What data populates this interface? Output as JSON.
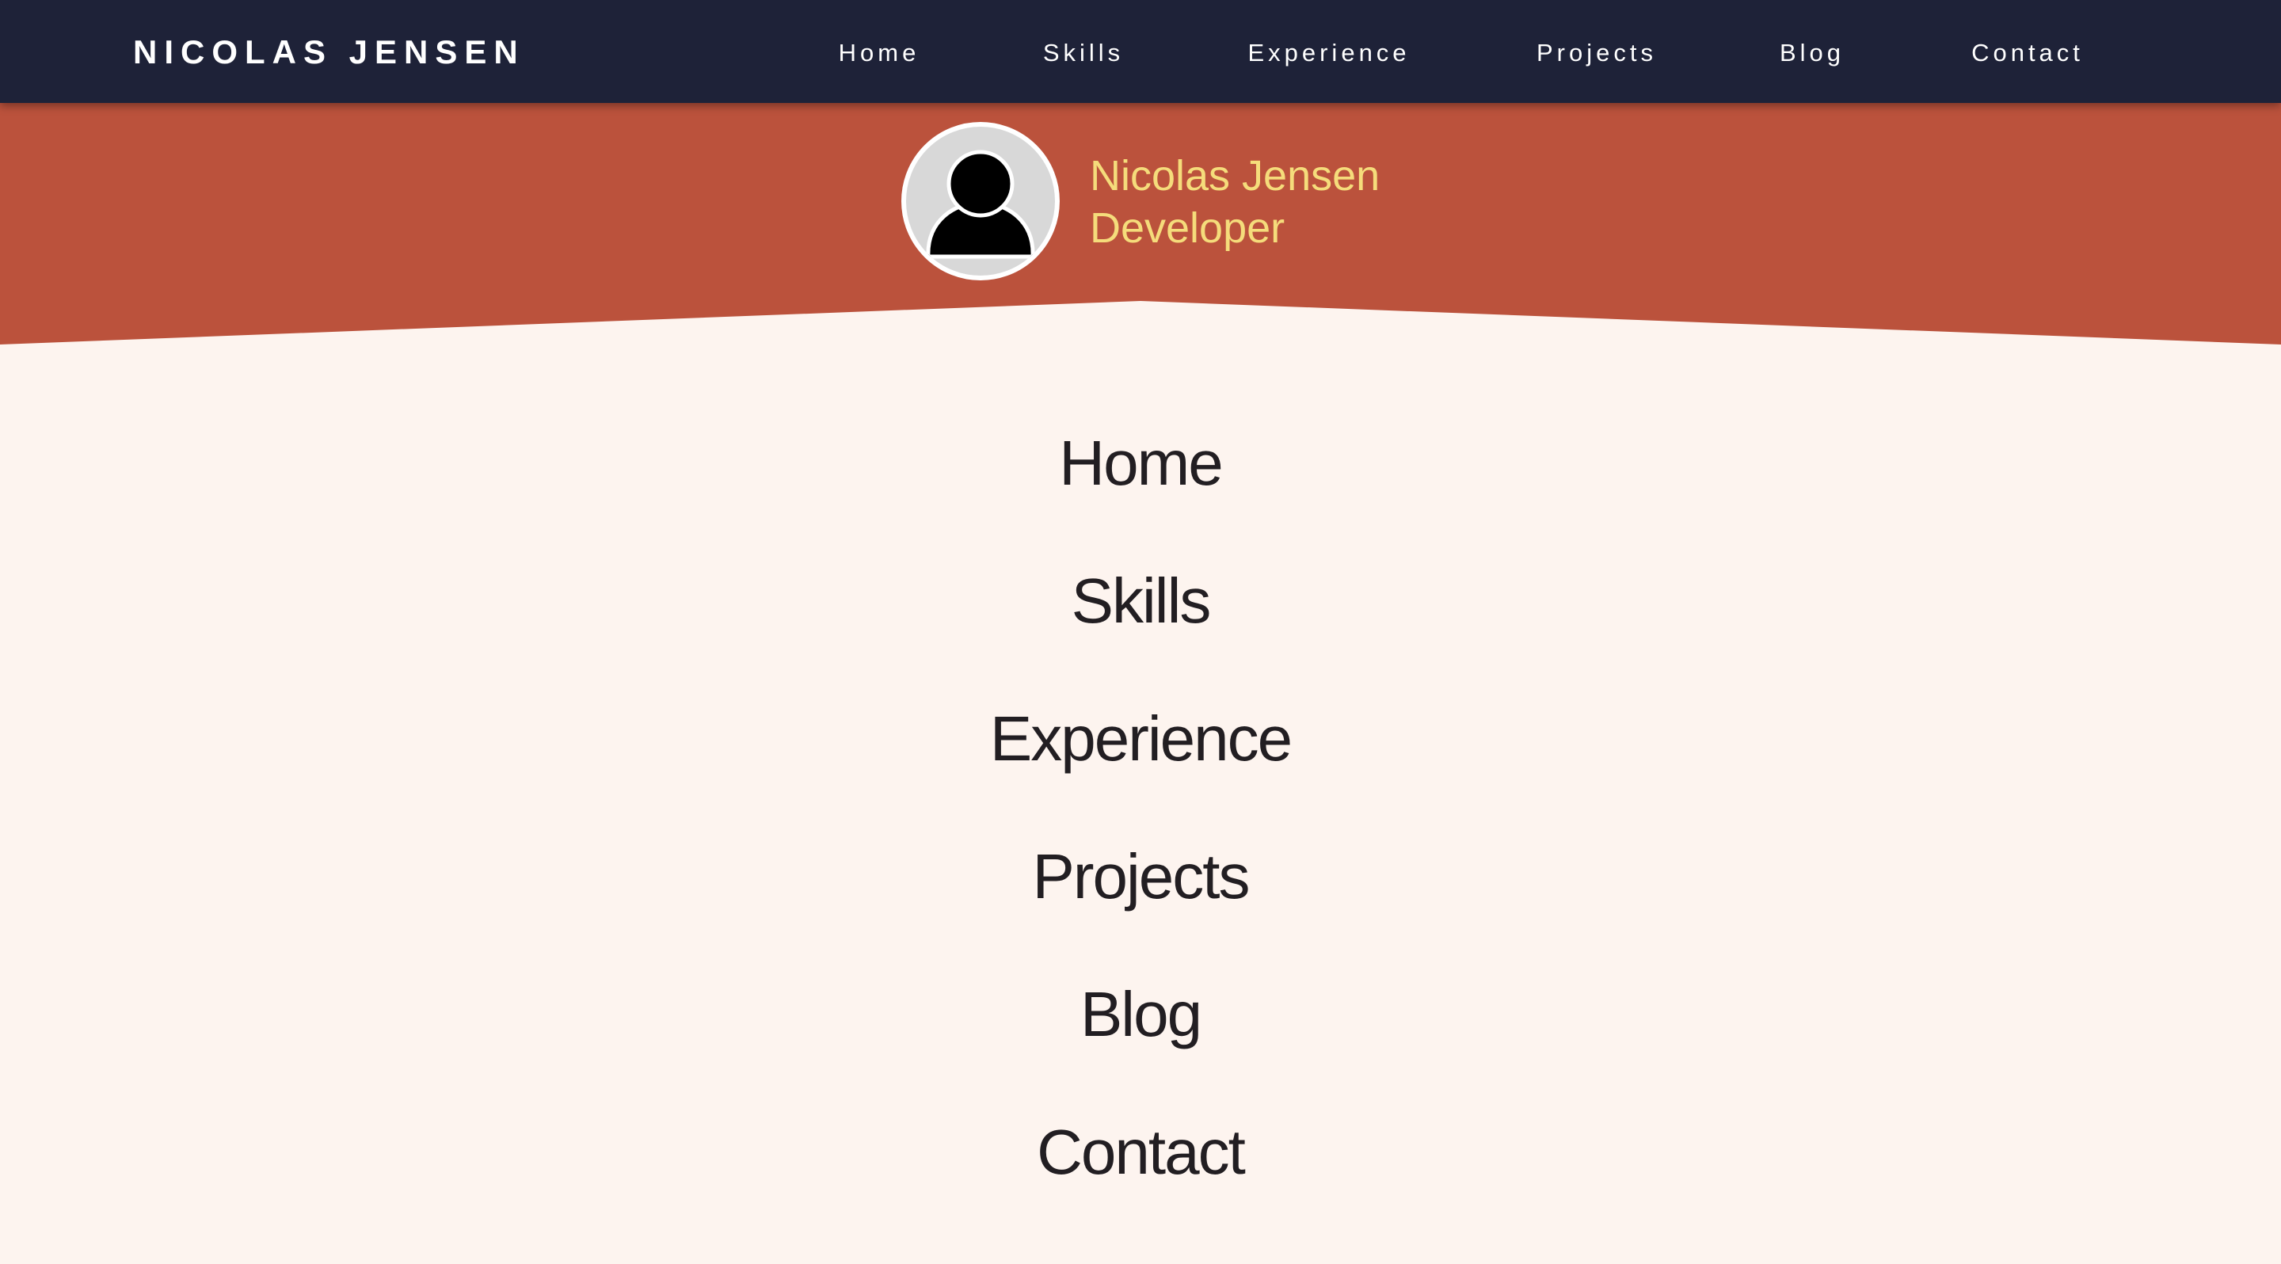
{
  "header": {
    "brand": "NICOLAS JENSEN",
    "nav": [
      "Home",
      "Skills",
      "Experience",
      "Projects",
      "Blog",
      "Contact"
    ]
  },
  "hero": {
    "name": "Nicolas Jensen",
    "role": "Developer",
    "avatar_icon": "user-silhouette-icon"
  },
  "menu": {
    "items": [
      "Home",
      "Skills",
      "Experience",
      "Projects",
      "Blog",
      "Contact"
    ]
  },
  "colors": {
    "topbar": "#1e2238",
    "hero": "#bb523c",
    "page_background": "#fdf4ef",
    "hero_text": "#f5dc7b",
    "menu_text": "#221e22"
  }
}
